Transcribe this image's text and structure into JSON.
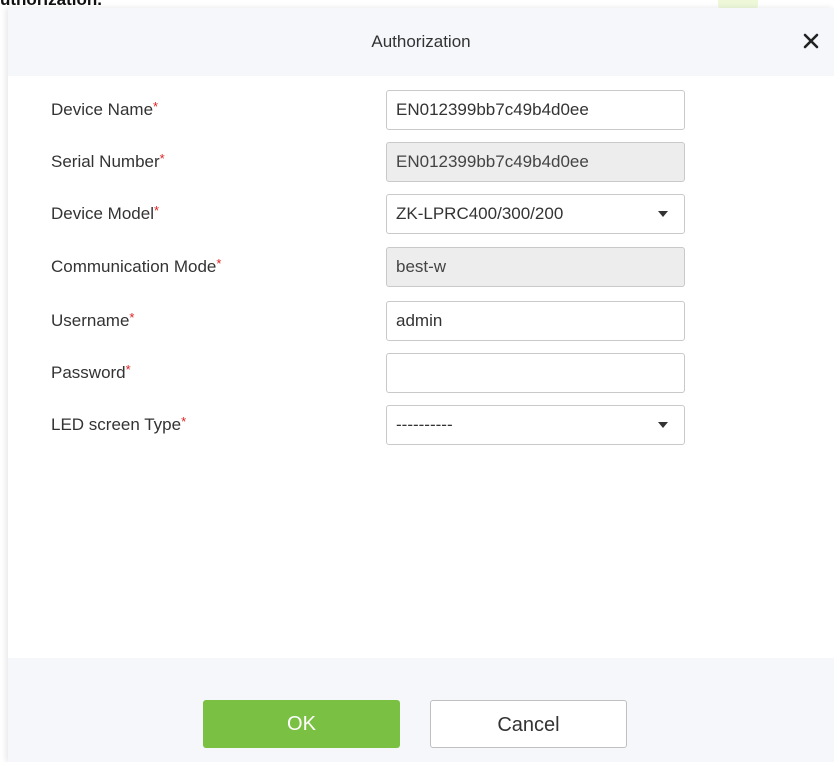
{
  "page": {
    "heading": "uthorization."
  },
  "dialog": {
    "title": "Authorization",
    "close_symbol": "×",
    "fields": [
      {
        "key": "device_name",
        "label": "Device Name",
        "value": "EN012399bb7c49b4d0ee",
        "readonly": false,
        "type": "text"
      },
      {
        "key": "serial_number",
        "label": "Serial Number",
        "value": "EN012399bb7c49b4d0ee",
        "readonly": true,
        "type": "text"
      },
      {
        "key": "device_model",
        "label": "Device Model",
        "value": "ZK-LPRC400/300/200",
        "readonly": false,
        "type": "select"
      },
      {
        "key": "communication_mode",
        "label": "Communication Mode",
        "value": "best-w",
        "readonly": true,
        "type": "text"
      },
      {
        "key": "username",
        "label": "Username",
        "value": "admin",
        "readonly": false,
        "type": "text"
      },
      {
        "key": "password",
        "label": "Password",
        "value": "",
        "readonly": false,
        "type": "password"
      },
      {
        "key": "led_screen_type",
        "label": "LED screen Type",
        "value": "----------",
        "readonly": false,
        "type": "select"
      }
    ],
    "required_marker": "*",
    "buttons": {
      "ok": "OK",
      "cancel": "Cancel"
    }
  },
  "colors": {
    "header_bg": "#f5f7fa",
    "ok_button": "#7ac143",
    "required": "#e02020",
    "readonly_bg": "#ededed"
  }
}
